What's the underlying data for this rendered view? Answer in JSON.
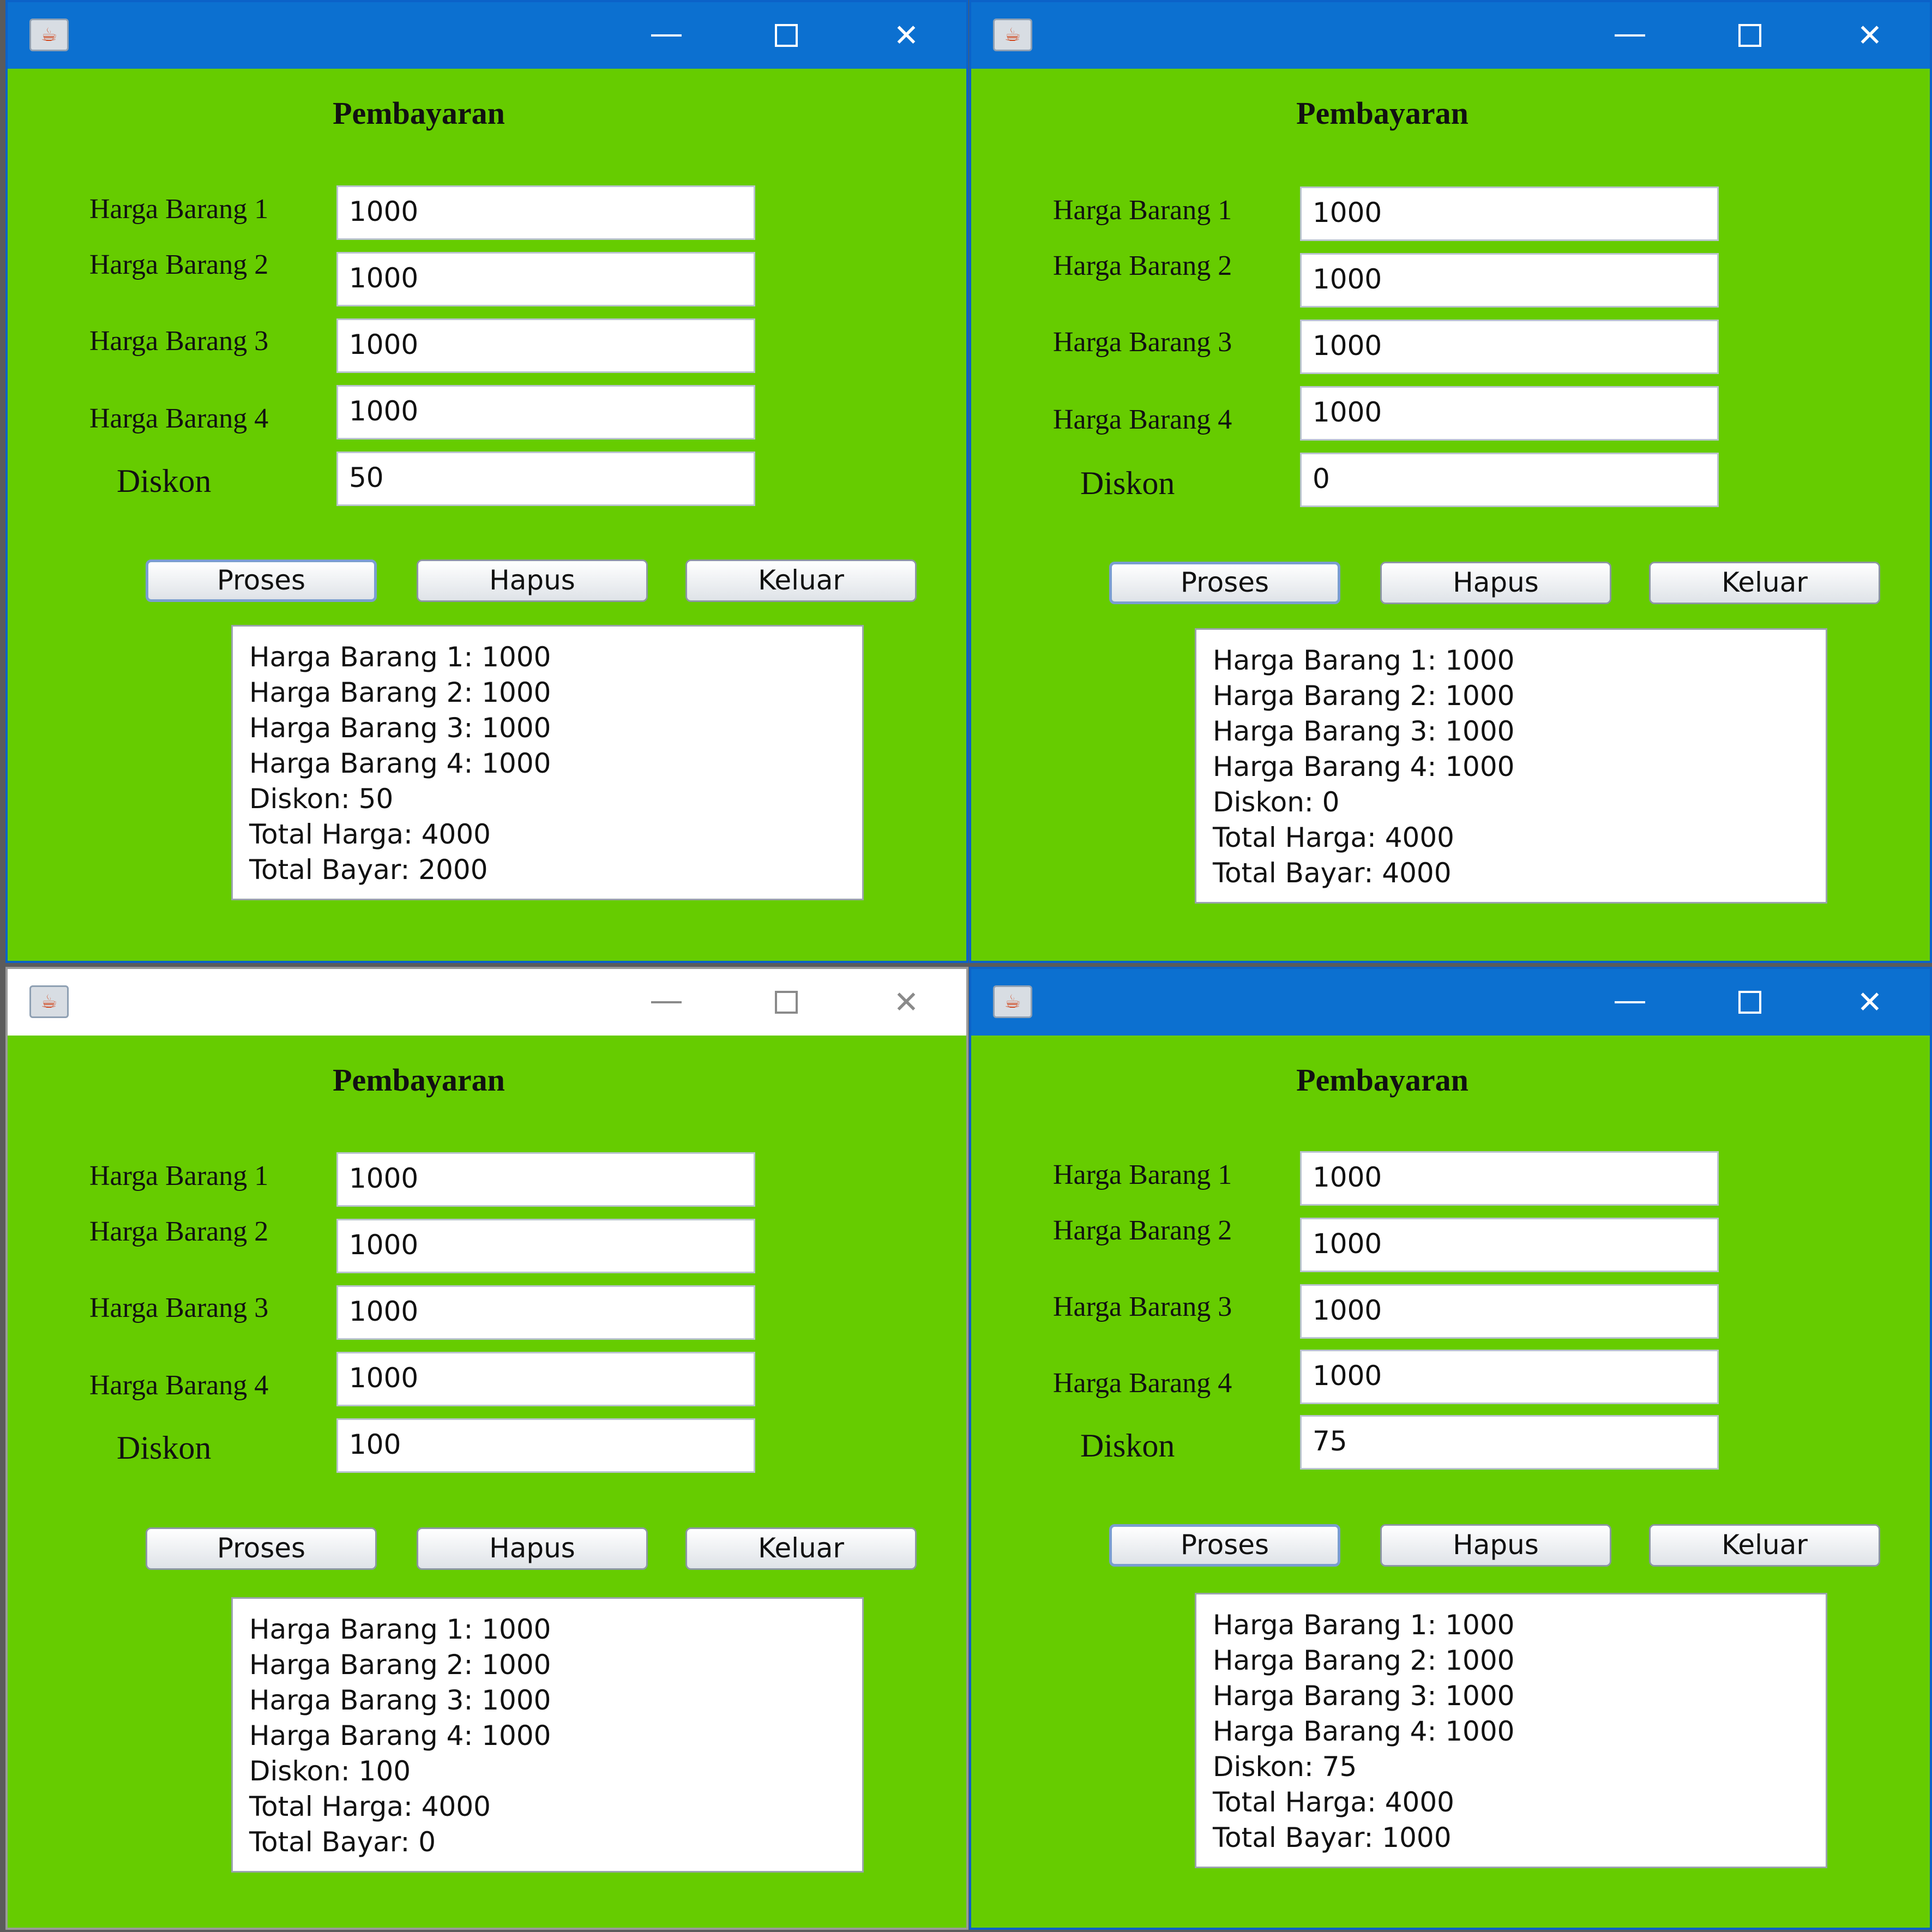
{
  "form": {
    "title": "Pembayaran",
    "labels": {
      "item1": "Harga Barang 1",
      "item2": "Harga Barang 2",
      "item3": "Harga Barang 3",
      "item4": "Harga Barang 4",
      "discount": "Diskon"
    },
    "buttons": {
      "process": "Proses",
      "clear": "Hapus",
      "exit": "Keluar"
    },
    "icons": {
      "app": "java-cup-icon",
      "minimize": "minimize-icon",
      "maximize": "maximize-icon",
      "close": "close-icon"
    }
  },
  "windows": [
    {
      "position": "top-left",
      "active": true,
      "fields": [
        "1000",
        "1000",
        "1000",
        "1000",
        "50"
      ],
      "output": [
        "Harga Barang 1: 1000",
        "Harga Barang 2: 1000",
        "Harga Barang 3: 1000",
        "Harga Barang 4: 1000",
        "Diskon: 50",
        "Total Harga: 4000",
        "Total Bayar: 2000"
      ]
    },
    {
      "position": "top-right",
      "active": true,
      "fields": [
        "1000",
        "1000",
        "1000",
        "1000",
        "0"
      ],
      "output": [
        "Harga Barang 1: 1000",
        "Harga Barang 2: 1000",
        "Harga Barang 3: 1000",
        "Harga Barang 4: 1000",
        "Diskon: 0",
        "Total Harga: 4000",
        "Total Bayar: 4000"
      ]
    },
    {
      "position": "bottom-left",
      "active": false,
      "fields": [
        "1000",
        "1000",
        "1000",
        "1000",
        "100"
      ],
      "output": [
        "Harga Barang 1: 1000",
        "Harga Barang 2: 1000",
        "Harga Barang 3: 1000",
        "Harga Barang 4: 1000",
        "Diskon: 100",
        "Total Harga: 4000",
        "Total Bayar: 0"
      ]
    },
    {
      "position": "bottom-right",
      "active": true,
      "fields": [
        "1000",
        "1000",
        "1000",
        "1000",
        "75"
      ],
      "output": [
        "Harga Barang 1: 1000",
        "Harga Barang 2: 1000",
        "Harga Barang 3: 1000",
        "Harga Barang 4: 1000",
        "Diskon: 75",
        "Total Harga: 4000",
        "Total Bayar: 1000"
      ]
    }
  ],
  "colors": {
    "titlebar_active": "#0c70d0",
    "titlebar_inactive": "#ffffff",
    "form_background": "#66cc00"
  }
}
